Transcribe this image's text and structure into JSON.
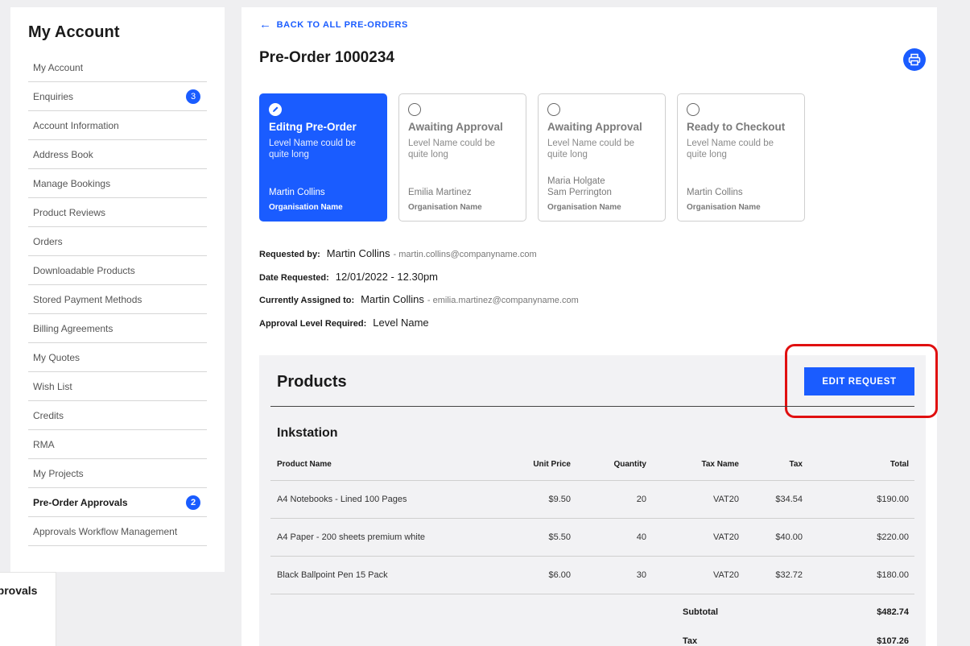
{
  "sidebar": {
    "title": "My Account",
    "items": [
      {
        "label": "My Account",
        "badge": ""
      },
      {
        "label": "Enquiries",
        "badge": "3"
      },
      {
        "label": "Account Information",
        "badge": ""
      },
      {
        "label": "Address Book",
        "badge": ""
      },
      {
        "label": "Manage Bookings",
        "badge": ""
      },
      {
        "label": "Product Reviews",
        "badge": ""
      },
      {
        "label": "Orders",
        "badge": ""
      },
      {
        "label": "Downloadable Products",
        "badge": ""
      },
      {
        "label": "Stored Payment Methods",
        "badge": ""
      },
      {
        "label": "Billing Agreements",
        "badge": ""
      },
      {
        "label": "My Quotes",
        "badge": ""
      },
      {
        "label": "Wish List",
        "badge": ""
      },
      {
        "label": "Credits",
        "badge": ""
      },
      {
        "label": "RMA",
        "badge": ""
      },
      {
        "label": "My Projects",
        "badge": ""
      },
      {
        "label": "Pre-Order Approvals",
        "badge": "2"
      },
      {
        "label": "Approvals Workflow Management",
        "badge": ""
      }
    ]
  },
  "popover": {
    "text": "Approvals"
  },
  "header": {
    "back_label": "BACK TO ALL PRE-ORDERS",
    "title": "Pre-Order 1000234",
    "print_icon": "printer-icon"
  },
  "steps": [
    {
      "title": "Editng Pre-Order",
      "level": "Level Name could be quite long",
      "people": "Martin Collins",
      "org": "Organisation Name",
      "state": "active"
    },
    {
      "title": "Awaiting Approval",
      "level": "Level Name could be quite long",
      "people": "Emilia Martinez",
      "org": "Organisation Name",
      "state": "pending"
    },
    {
      "title": "Awaiting Approval",
      "level": "Level Name could be quite long",
      "people": "Maria Holgate\nSam Perrington",
      "org": "Organisation Name",
      "state": "pending"
    },
    {
      "title": "Ready to Checkout",
      "level": "Level Name could be quite long",
      "people": "Martin Collins",
      "org": "Organisation Name",
      "state": "pending"
    }
  ],
  "meta": {
    "requested_by_label": "Requested by:",
    "requested_by": "Martin Collins",
    "requested_by_email": "- martin.collins@companyname.com",
    "date_label": "Date Requested:",
    "date": "12/01/2022 - 12.30pm",
    "assigned_label": "Currently Assigned to:",
    "assigned": "Martin Collins",
    "assigned_email": "- emilia.martinez@companyname.com",
    "level_label": "Approval Level Required:",
    "level": "Level Name"
  },
  "products": {
    "title": "Products",
    "edit_label": "EDIT REQUEST",
    "group": "Inkstation",
    "columns": [
      "Product Name",
      "Unit Price",
      "Quantity",
      "Tax Name",
      "Tax",
      "Total"
    ],
    "rows": [
      [
        "A4 Notebooks - Lined 100 Pages",
        "$9.50",
        "20",
        "VAT20",
        "$34.54",
        "$190.00"
      ],
      [
        "A4 Paper - 200 sheets premium white",
        "$5.50",
        "40",
        "VAT20",
        "$40.00",
        "$220.00"
      ],
      [
        "Black Ballpoint Pen 15 Pack",
        "$6.00",
        "30",
        "VAT20",
        "$32.72",
        "$180.00"
      ]
    ],
    "subtotal_label": "Subtotal",
    "subtotal": "$482.74",
    "tax_label": "Tax",
    "tax": "$107.26"
  },
  "colors": {
    "accent": "#1a5cff",
    "highlight": "#e01010"
  }
}
